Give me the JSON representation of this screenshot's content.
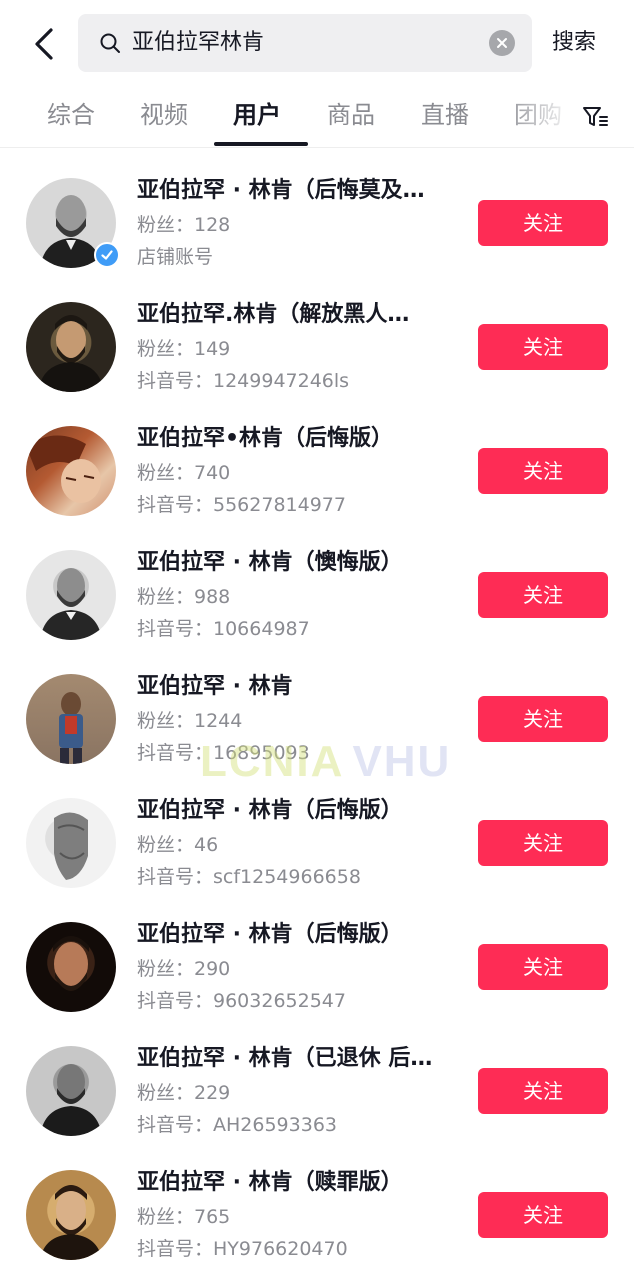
{
  "header": {
    "search_query": "亚伯拉罕林肯",
    "search_button": "搜索"
  },
  "tabs": [
    {
      "label": "综合"
    },
    {
      "label": "视频"
    },
    {
      "label": "用户"
    },
    {
      "label": "商品"
    },
    {
      "label": "直播"
    },
    {
      "label": "团购"
    }
  ],
  "users": [
    {
      "name": "亚伯拉罕 · 林肯（后悔莫及…",
      "fans": "粉丝：128",
      "sub": "店铺账号",
      "follow": "关注",
      "verified": true
    },
    {
      "name": "亚伯拉罕.林肯（解放黑人…",
      "fans": "粉丝：149",
      "sub": "抖音号：1249947246ls",
      "follow": "关注"
    },
    {
      "name": "亚伯拉罕•林肯（后悔版）",
      "fans": "粉丝：740",
      "sub": "抖音号：55627814977",
      "follow": "关注"
    },
    {
      "name": "亚伯拉罕 · 林肯（懊悔版）",
      "fans": "粉丝：988",
      "sub": "抖音号：10664987",
      "follow": "关注"
    },
    {
      "name": "亚伯拉罕 · 林肯",
      "fans": "粉丝：1244",
      "sub": "抖音号：16895093",
      "follow": "关注"
    },
    {
      "name": "亚伯拉罕 · 林肯（后悔版）",
      "fans": "粉丝：46",
      "sub": "抖音号：scf1254966658",
      "follow": "关注"
    },
    {
      "name": "亚伯拉罕 · 林肯（后悔版）",
      "fans": "粉丝：290",
      "sub": "抖音号：96032652547",
      "follow": "关注"
    },
    {
      "name": "亚伯拉罕 · 林肯（已退休 后…",
      "fans": "粉丝：229",
      "sub": "抖音号：AH26593363",
      "follow": "关注"
    },
    {
      "name": "亚伯拉罕 · 林肯（赎罪版）",
      "fans": "粉丝：765",
      "sub": "抖音号：HY976620470",
      "follow": "关注"
    }
  ],
  "watermark": {
    "part1": "LCNIA",
    "part2": "VHU"
  },
  "colors": {
    "accent": "#fe2c55",
    "verified": "#3f9cf7",
    "text_secondary": "#8a8b91"
  }
}
